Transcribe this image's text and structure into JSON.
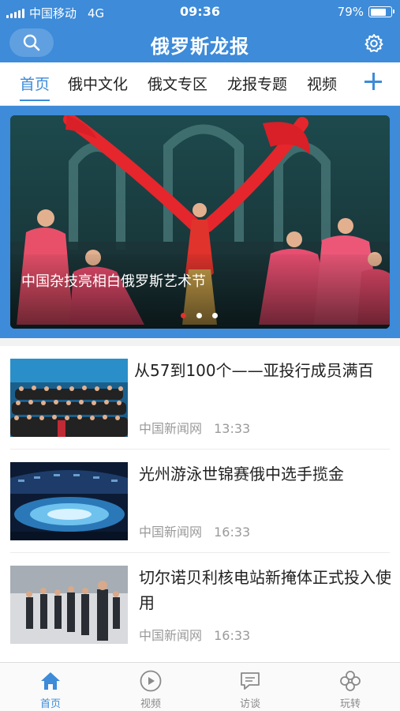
{
  "status_bar": {
    "carrier": "中国移动",
    "network": "4G",
    "time": "09:36",
    "battery_text": "79%",
    "battery_level": 0.79
  },
  "header": {
    "title": "俄罗斯龙报",
    "search_icon": "search-icon",
    "settings_icon": "gear-icon"
  },
  "tabs": [
    {
      "label": "首页",
      "active": true
    },
    {
      "label": "俄中文化",
      "active": false
    },
    {
      "label": "俄文专区",
      "active": false
    },
    {
      "label": "龙报专题",
      "active": false
    },
    {
      "label": "视频",
      "active": false
    }
  ],
  "banner": {
    "caption": "中国杂技亮相白俄罗斯艺术节",
    "slides": 3,
    "active_slide": 1
  },
  "news": [
    {
      "title": "从57到100个——亚投行成员满百",
      "source": "中国新闻网",
      "time": "13:33"
    },
    {
      "title": "光州游泳世锦赛俄中选手揽金",
      "source": "中国新闻网",
      "time": "16:33"
    },
    {
      "title": "切尔诺贝利核电站新掩体正式投入使用",
      "source": "中国新闻网",
      "time": "16:33"
    }
  ],
  "bottom_nav": [
    {
      "label": "首页",
      "icon": "home-icon",
      "active": true
    },
    {
      "label": "视频",
      "icon": "play-icon",
      "active": false
    },
    {
      "label": "访谈",
      "icon": "chat-icon",
      "active": false
    },
    {
      "label": "玩转",
      "icon": "flower-icon",
      "active": false
    }
  ],
  "colors": {
    "brand": "#3d8bd9",
    "dot_active": "#e0332c"
  }
}
